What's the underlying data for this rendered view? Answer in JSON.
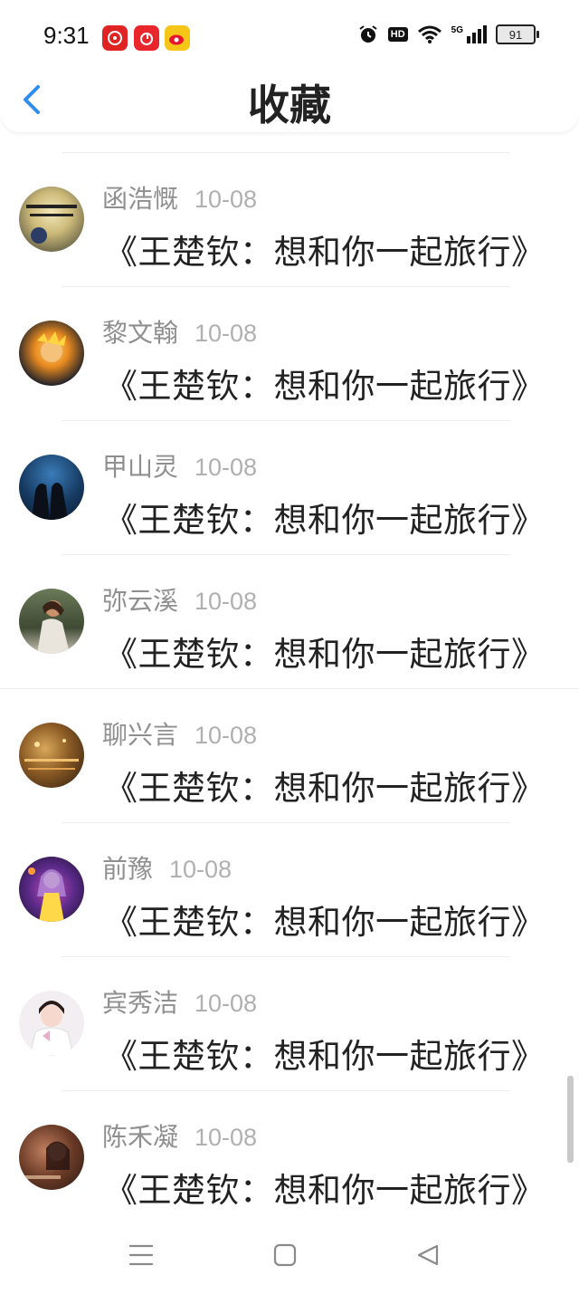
{
  "status_bar": {
    "time": "9:31",
    "network": "5G",
    "hd": "HD",
    "battery": "91"
  },
  "header": {
    "title": "收藏"
  },
  "items": [
    {
      "name": "函浩慨",
      "date": "10-08",
      "title": "《王楚钦：想和你一起旅行》"
    },
    {
      "name": "黎文翰",
      "date": "10-08",
      "title": "《王楚钦：想和你一起旅行》"
    },
    {
      "name": "甲山灵",
      "date": "10-08",
      "title": "《王楚钦：想和你一起旅行》"
    },
    {
      "name": "弥云溪",
      "date": "10-08",
      "title": "《王楚钦：想和你一起旅行》"
    },
    {
      "name": "聊兴言",
      "date": "10-08",
      "title": "《王楚钦：想和你一起旅行》"
    },
    {
      "name": "前豫",
      "date": "10-08",
      "title": "《王楚钦：想和你一起旅行》"
    },
    {
      "name": "宾秀洁",
      "date": "10-08",
      "title": "《王楚钦：想和你一起旅行》"
    },
    {
      "name": "陈禾凝",
      "date": "10-08",
      "title": "《王楚钦：想和你一起旅行》"
    }
  ],
  "colors": {
    "accent": "#2f8cf0",
    "text": "#222222",
    "muted": "#8f8f8f"
  }
}
